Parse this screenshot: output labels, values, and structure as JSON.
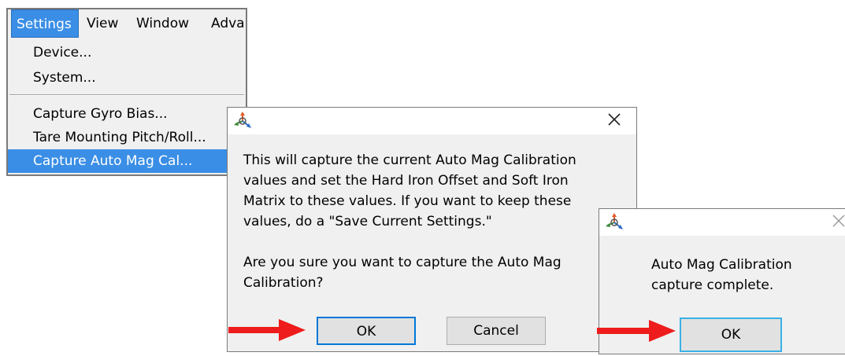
{
  "menu": {
    "menubar": {
      "settings": "Settings",
      "view": "View",
      "window": "Window",
      "advanced": "Adva"
    },
    "items": [
      {
        "label": "Device..."
      },
      {
        "label": "System..."
      },
      {
        "label": "Capture Gyro Bias..."
      },
      {
        "label": "Tare Mounting Pitch/Roll..."
      },
      {
        "label": "Capture Auto Mag Cal..."
      }
    ],
    "highlighted_item": "Capture Auto Mag Cal..."
  },
  "confirm_dialog": {
    "lines": [
      "This will capture the current Auto Mag Calibration",
      "values and set the Hard Iron Offset and Soft Iron",
      "Matrix to these values. If you want to keep these",
      "values, do a \"Save Current Settings.\""
    ],
    "question_lines": [
      "Are you sure you want to capture the Auto Mag",
      "Calibration?"
    ],
    "ok_label": "OK",
    "cancel_label": "Cancel",
    "close_glyph": "✕"
  },
  "complete_dialog": {
    "lines": [
      "Auto Mag Calibration",
      "capture complete."
    ],
    "ok_label": "OK",
    "close_glyph": "✕"
  },
  "colors": {
    "highlight": "#3a8ee6",
    "dialog_bg": "#f0f0f0",
    "arrow": "#ee1c1c",
    "default_button_border": "#0078d7"
  },
  "icons": [
    "app-icon",
    "close-icon",
    "red-arrow-icon"
  ]
}
